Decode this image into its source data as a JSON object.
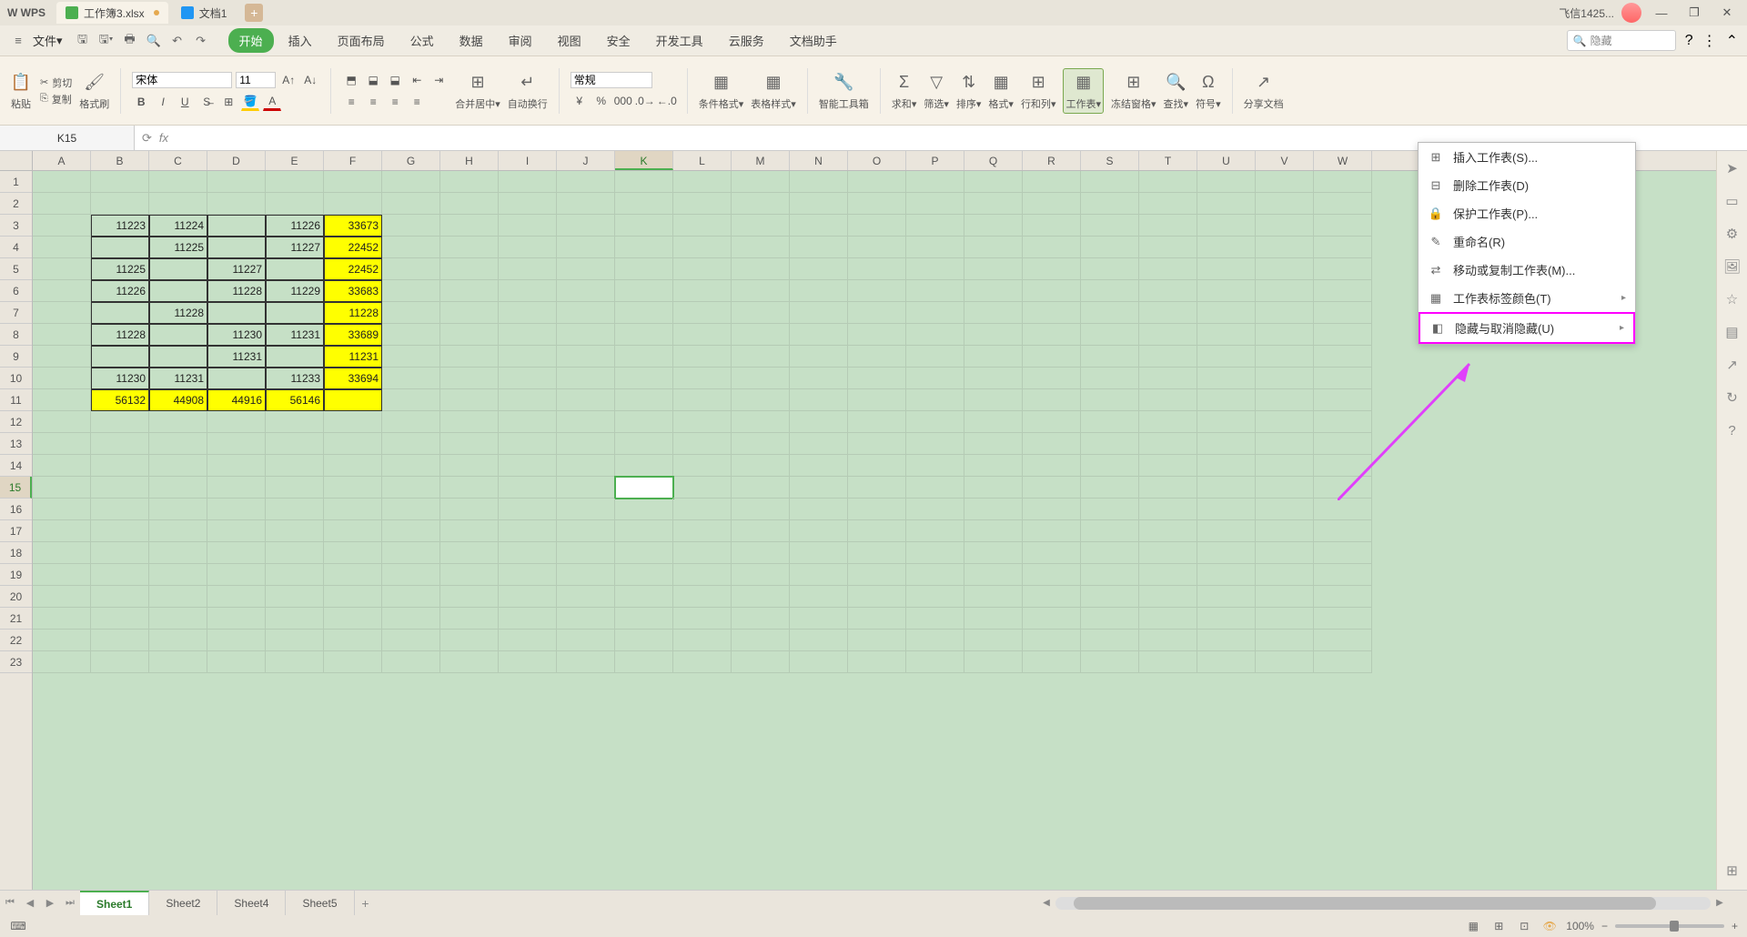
{
  "titleBar": {
    "logo": "W WPS",
    "tabs": [
      {
        "label": "工作簿3.xlsx",
        "iconClass": "green",
        "modified": true,
        "active": true
      },
      {
        "label": "文档1",
        "iconClass": "blue",
        "modified": false,
        "active": false
      }
    ],
    "addTab": "+",
    "user": "飞信1425...",
    "winMin": "—",
    "winMax": "❐",
    "winClose": "✕"
  },
  "menuBar": {
    "fileMenu": "文件",
    "mtabs": [
      "开始",
      "插入",
      "页面布局",
      "公式",
      "数据",
      "审阅",
      "视图",
      "安全",
      "开发工具",
      "云服务",
      "文档助手"
    ],
    "activeIndex": 0,
    "searchPlaceholder": "隐藏"
  },
  "ribbon": {
    "paste": "粘贴",
    "cut": "剪切",
    "copy": "复制",
    "formatPainter": "格式刷",
    "fontName": "宋体",
    "fontSize": "11",
    "mergeCenter": "合并居中",
    "autoWrap": "自动换行",
    "numberFormat": "常规",
    "condFormat": "条件格式",
    "tableStyle": "表格样式",
    "smartToolbox": "智能工具箱",
    "sum": "求和",
    "filter": "筛选",
    "sort": "排序",
    "format": "格式",
    "rowCol": "行和列",
    "worksheet": "工作表",
    "freezePanes": "冻结窗格",
    "find": "查找",
    "symbol": "符号",
    "share": "分享文档"
  },
  "formulaBar": {
    "nameBox": "K15",
    "fxInput": ""
  },
  "columns": [
    "A",
    "B",
    "C",
    "D",
    "E",
    "F",
    "G",
    "H",
    "I",
    "J",
    "K",
    "L",
    "M",
    "N",
    "O",
    "P",
    "Q",
    "R",
    "S",
    "T",
    "U",
    "V",
    "W"
  ],
  "selectedCol": "K",
  "rows": [
    1,
    2,
    3,
    4,
    5,
    6,
    7,
    8,
    9,
    10,
    11,
    12,
    13,
    14,
    15,
    16,
    17,
    18,
    19,
    20,
    21,
    22,
    23
  ],
  "selectedRow": 15,
  "cellData": {
    "3": {
      "B": "11223",
      "C": "11224",
      "E": "11226",
      "F": "33673"
    },
    "4": {
      "C": "11225",
      "E": "11227",
      "F": "22452"
    },
    "5": {
      "B": "11225",
      "D": "11227",
      "F": "22452"
    },
    "6": {
      "B": "11226",
      "D": "11228",
      "E": "11229",
      "F": "33683"
    },
    "7": {
      "C": "11228",
      "F": "11228"
    },
    "8": {
      "B": "11228",
      "D": "11230",
      "E": "11231",
      "F": "33689"
    },
    "9": {
      "D": "11231",
      "F": "11231"
    },
    "10": {
      "B": "11230",
      "C": "11231",
      "E": "11233",
      "F": "33694"
    },
    "11": {
      "B": "56132",
      "C": "44908",
      "D": "44916",
      "E": "56146"
    }
  },
  "yellowCells": {
    "3": [
      "F"
    ],
    "4": [
      "F"
    ],
    "5": [
      "F"
    ],
    "6": [
      "F"
    ],
    "7": [
      "F"
    ],
    "8": [
      "F"
    ],
    "9": [
      "F"
    ],
    "10": [
      "F"
    ],
    "11": [
      "B",
      "C",
      "D",
      "E",
      "F"
    ]
  },
  "borderedRegion": {
    "rowStart": 3,
    "rowEnd": 11,
    "colStart": "B",
    "colEnd": "F"
  },
  "dropdown": {
    "items": [
      {
        "icon": "⊞",
        "label": "插入工作表(S)..."
      },
      {
        "icon": "⊟",
        "label": "删除工作表(D)"
      },
      {
        "icon": "🔒",
        "label": "保护工作表(P)..."
      },
      {
        "icon": "✎",
        "label": "重命名(R)"
      },
      {
        "icon": "⇄",
        "label": "移动或复制工作表(M)..."
      },
      {
        "icon": "▦",
        "label": "工作表标签颜色(T)",
        "hasArrow": true
      },
      {
        "icon": "◧",
        "label": "隐藏与取消隐藏(U)",
        "hasArrow": true,
        "highlighted": true
      }
    ]
  },
  "sheetTabs": {
    "tabs": [
      "Sheet1",
      "Sheet2",
      "Sheet4",
      "Sheet5"
    ],
    "activeIndex": 0,
    "add": "+"
  },
  "statusBar": {
    "zoomPct": "100%"
  }
}
